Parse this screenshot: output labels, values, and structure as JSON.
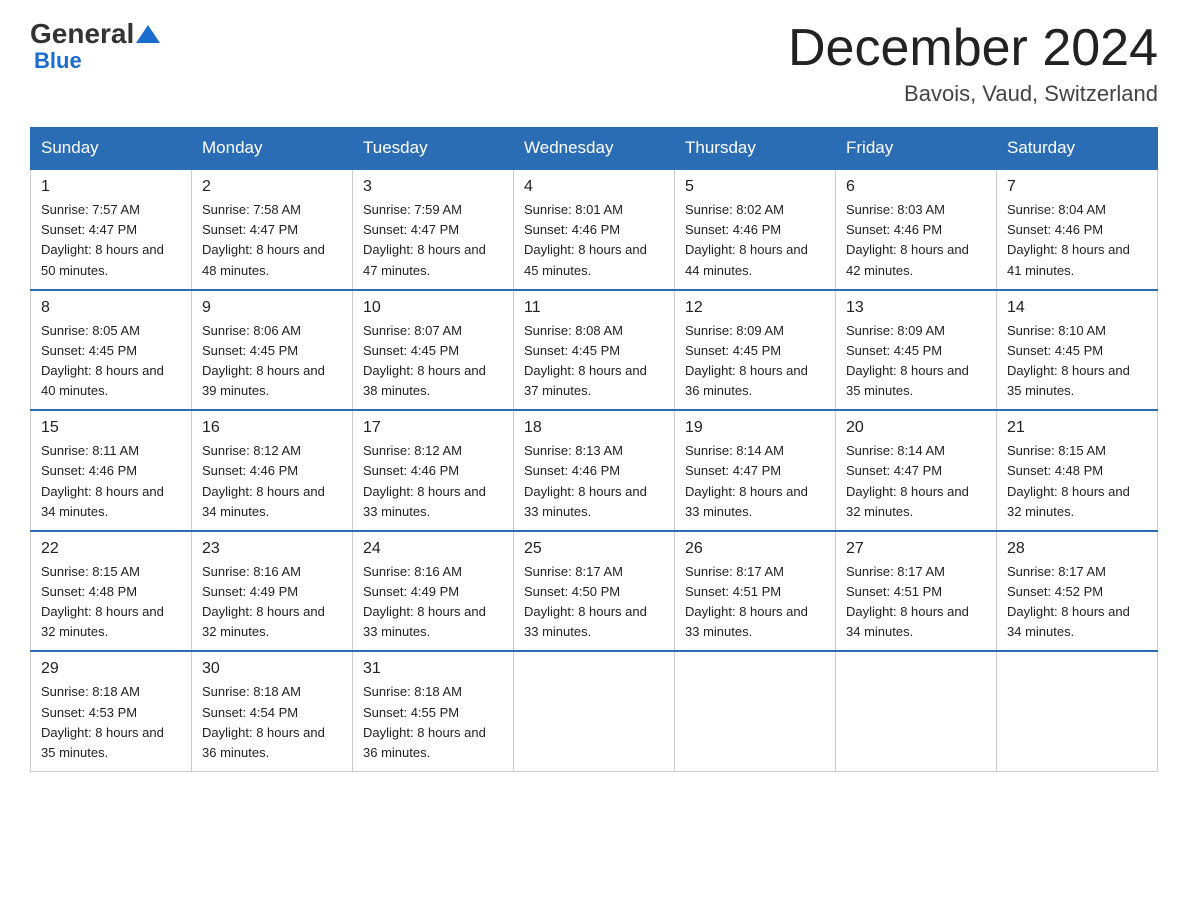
{
  "header": {
    "logo_general": "General",
    "logo_blue": "Blue",
    "month_title": "December 2024",
    "location": "Bavois, Vaud, Switzerland"
  },
  "weekdays": [
    "Sunday",
    "Monday",
    "Tuesday",
    "Wednesday",
    "Thursday",
    "Friday",
    "Saturday"
  ],
  "weeks": [
    [
      {
        "day": "1",
        "sunrise": "7:57 AM",
        "sunset": "4:47 PM",
        "daylight": "8 hours and 50 minutes."
      },
      {
        "day": "2",
        "sunrise": "7:58 AM",
        "sunset": "4:47 PM",
        "daylight": "8 hours and 48 minutes."
      },
      {
        "day": "3",
        "sunrise": "7:59 AM",
        "sunset": "4:47 PM",
        "daylight": "8 hours and 47 minutes."
      },
      {
        "day": "4",
        "sunrise": "8:01 AM",
        "sunset": "4:46 PM",
        "daylight": "8 hours and 45 minutes."
      },
      {
        "day": "5",
        "sunrise": "8:02 AM",
        "sunset": "4:46 PM",
        "daylight": "8 hours and 44 minutes."
      },
      {
        "day": "6",
        "sunrise": "8:03 AM",
        "sunset": "4:46 PM",
        "daylight": "8 hours and 42 minutes."
      },
      {
        "day": "7",
        "sunrise": "8:04 AM",
        "sunset": "4:46 PM",
        "daylight": "8 hours and 41 minutes."
      }
    ],
    [
      {
        "day": "8",
        "sunrise": "8:05 AM",
        "sunset": "4:45 PM",
        "daylight": "8 hours and 40 minutes."
      },
      {
        "day": "9",
        "sunrise": "8:06 AM",
        "sunset": "4:45 PM",
        "daylight": "8 hours and 39 minutes."
      },
      {
        "day": "10",
        "sunrise": "8:07 AM",
        "sunset": "4:45 PM",
        "daylight": "8 hours and 38 minutes."
      },
      {
        "day": "11",
        "sunrise": "8:08 AM",
        "sunset": "4:45 PM",
        "daylight": "8 hours and 37 minutes."
      },
      {
        "day": "12",
        "sunrise": "8:09 AM",
        "sunset": "4:45 PM",
        "daylight": "8 hours and 36 minutes."
      },
      {
        "day": "13",
        "sunrise": "8:09 AM",
        "sunset": "4:45 PM",
        "daylight": "8 hours and 35 minutes."
      },
      {
        "day": "14",
        "sunrise": "8:10 AM",
        "sunset": "4:45 PM",
        "daylight": "8 hours and 35 minutes."
      }
    ],
    [
      {
        "day": "15",
        "sunrise": "8:11 AM",
        "sunset": "4:46 PM",
        "daylight": "8 hours and 34 minutes."
      },
      {
        "day": "16",
        "sunrise": "8:12 AM",
        "sunset": "4:46 PM",
        "daylight": "8 hours and 34 minutes."
      },
      {
        "day": "17",
        "sunrise": "8:12 AM",
        "sunset": "4:46 PM",
        "daylight": "8 hours and 33 minutes."
      },
      {
        "day": "18",
        "sunrise": "8:13 AM",
        "sunset": "4:46 PM",
        "daylight": "8 hours and 33 minutes."
      },
      {
        "day": "19",
        "sunrise": "8:14 AM",
        "sunset": "4:47 PM",
        "daylight": "8 hours and 33 minutes."
      },
      {
        "day": "20",
        "sunrise": "8:14 AM",
        "sunset": "4:47 PM",
        "daylight": "8 hours and 32 minutes."
      },
      {
        "day": "21",
        "sunrise": "8:15 AM",
        "sunset": "4:48 PM",
        "daylight": "8 hours and 32 minutes."
      }
    ],
    [
      {
        "day": "22",
        "sunrise": "8:15 AM",
        "sunset": "4:48 PM",
        "daylight": "8 hours and 32 minutes."
      },
      {
        "day": "23",
        "sunrise": "8:16 AM",
        "sunset": "4:49 PM",
        "daylight": "8 hours and 32 minutes."
      },
      {
        "day": "24",
        "sunrise": "8:16 AM",
        "sunset": "4:49 PM",
        "daylight": "8 hours and 33 minutes."
      },
      {
        "day": "25",
        "sunrise": "8:17 AM",
        "sunset": "4:50 PM",
        "daylight": "8 hours and 33 minutes."
      },
      {
        "day": "26",
        "sunrise": "8:17 AM",
        "sunset": "4:51 PM",
        "daylight": "8 hours and 33 minutes."
      },
      {
        "day": "27",
        "sunrise": "8:17 AM",
        "sunset": "4:51 PM",
        "daylight": "8 hours and 34 minutes."
      },
      {
        "day": "28",
        "sunrise": "8:17 AM",
        "sunset": "4:52 PM",
        "daylight": "8 hours and 34 minutes."
      }
    ],
    [
      {
        "day": "29",
        "sunrise": "8:18 AM",
        "sunset": "4:53 PM",
        "daylight": "8 hours and 35 minutes."
      },
      {
        "day": "30",
        "sunrise": "8:18 AM",
        "sunset": "4:54 PM",
        "daylight": "8 hours and 36 minutes."
      },
      {
        "day": "31",
        "sunrise": "8:18 AM",
        "sunset": "4:55 PM",
        "daylight": "8 hours and 36 minutes."
      },
      null,
      null,
      null,
      null
    ]
  ]
}
